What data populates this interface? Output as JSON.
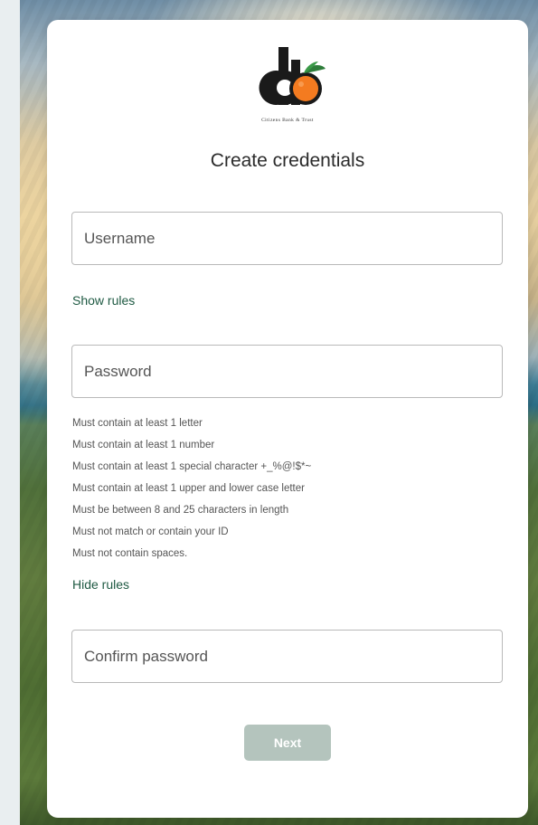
{
  "brand": {
    "logo_icon": "citizens-bank-cb-logo",
    "name": "Citizens Bank & Trust",
    "colors": {
      "dark": "#1a1a1a",
      "orange": "#f47b20",
      "leaf": "#2e7d3a"
    }
  },
  "form": {
    "title": "Create credentials",
    "username": {
      "placeholder": "Username",
      "value": ""
    },
    "show_rules": "Show rules",
    "password": {
      "placeholder": "Password",
      "value": ""
    },
    "rules": [
      "Must contain at least 1 letter",
      "Must contain at least 1 number",
      "Must contain at least 1 special character +_%@!$*~",
      "Must contain at least 1 upper and lower case letter",
      "Must be between 8 and 25 characters in length",
      "Must not match or contain your ID",
      "Must not contain spaces."
    ],
    "hide_rules": "Hide rules",
    "confirm": {
      "placeholder": "Confirm password",
      "value": ""
    },
    "next_label": "Next"
  },
  "colors": {
    "link": "#1f5a43",
    "button_disabled_bg": "#b4c4bd"
  }
}
